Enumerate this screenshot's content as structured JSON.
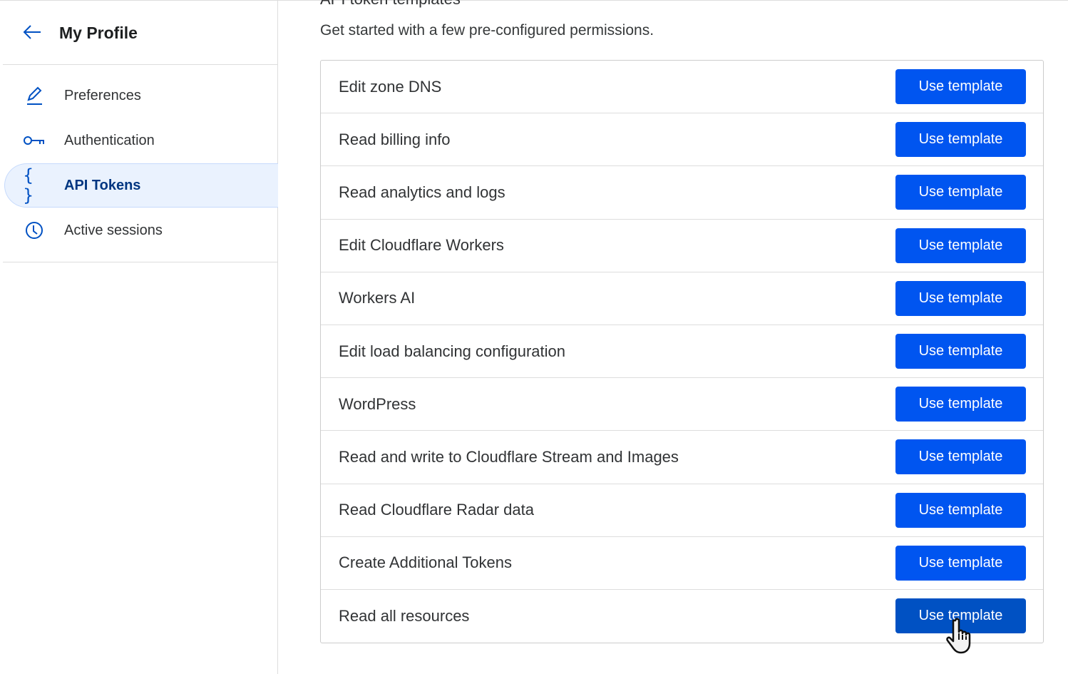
{
  "sidebar": {
    "title": "My Profile",
    "items": [
      {
        "label": "Preferences",
        "icon": "pencil-icon"
      },
      {
        "label": "Authentication",
        "icon": "key-icon"
      },
      {
        "label": "API Tokens",
        "icon": "braces-icon",
        "active": true
      },
      {
        "label": "Active sessions",
        "icon": "clock-icon"
      }
    ]
  },
  "main": {
    "heading": "API token templates",
    "subtitle": "Get started with a few pre-configured permissions.",
    "button_label": "Use template",
    "templates": [
      "Edit zone DNS",
      "Read billing info",
      "Read analytics and logs",
      "Edit Cloudflare Workers",
      "Workers AI",
      "Edit load balancing configuration",
      "WordPress",
      "Read and write to Cloudflare Stream and Images",
      "Read Cloudflare Radar data",
      "Create Additional Tokens",
      "Read all resources"
    ]
  },
  "colors": {
    "accent": "#0055f0",
    "accent_hover": "#0051c3",
    "active_bg": "#eaf2fe"
  }
}
